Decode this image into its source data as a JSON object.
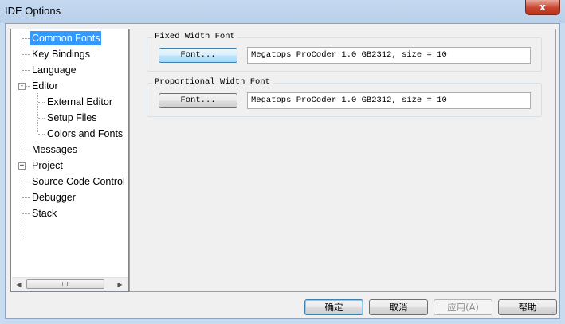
{
  "window": {
    "title": "IDE Options",
    "close_glyph": "x"
  },
  "tree": {
    "items": [
      {
        "label": "Common Fonts",
        "selected": true
      },
      {
        "label": "Key Bindings"
      },
      {
        "label": "Language"
      },
      {
        "label": "Editor",
        "expander": "-"
      },
      {
        "label": "External Editor"
      },
      {
        "label": "Setup Files"
      },
      {
        "label": "Colors and Fonts"
      },
      {
        "label": "Messages"
      },
      {
        "label": "Project",
        "expander": "+"
      },
      {
        "label": "Source Code Control"
      },
      {
        "label": "Debugger"
      },
      {
        "label": "Stack"
      }
    ],
    "scroll_thumb_glyph": "III",
    "scroll_left_glyph": "◀",
    "scroll_right_glyph": "▶"
  },
  "fixed_group": {
    "title": "Fixed Width Font",
    "button_label": "Font...",
    "value": "Megatops ProCoder 1.0 GB2312, size = 10"
  },
  "proportional_group": {
    "title": "Proportional Width Font",
    "button_label": "Font...",
    "value": "Megatops ProCoder 1.0 GB2312, size = 10"
  },
  "buttons": {
    "ok": "确定",
    "cancel": "取消",
    "apply": "应用(A)",
    "help": "帮助"
  },
  "colors": {
    "selection": "#3399ff",
    "titlebar": "#c5d9f0",
    "close": "#c9452f"
  }
}
